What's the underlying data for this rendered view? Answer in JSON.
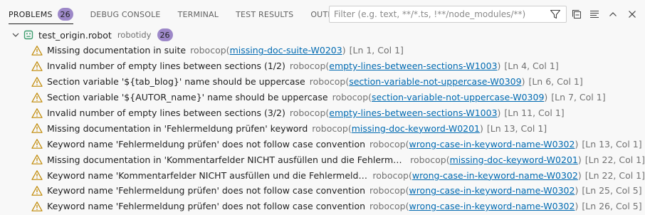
{
  "tabs": [
    {
      "label": "PROBLEMS",
      "badge": "26"
    },
    {
      "label": "DEBUG CONSOLE"
    },
    {
      "label": "TERMINAL"
    },
    {
      "label": "TEST RESULTS"
    },
    {
      "label": "OUTPUT"
    }
  ],
  "filter": {
    "placeholder": "Filter (e.g. text, **/*.ts, !**/node_modules/**)"
  },
  "file": {
    "name": "test_origin.robot",
    "dir": "robotidy",
    "count": "26"
  },
  "problems": [
    {
      "message": "Missing documentation in suite",
      "source": "robocop",
      "code": "missing-doc-suite-W0203",
      "location": "[Ln 1, Col 1]"
    },
    {
      "message": "Invalid number of empty lines between sections (1/2)",
      "source": "robocop",
      "code": "empty-lines-between-sections-W1003",
      "location": "[Ln 4, Col 1]"
    },
    {
      "message": "Section variable '${tab_blog}' name should be uppercase",
      "source": "robocop",
      "code": "section-variable-not-uppercase-W0309",
      "location": "[Ln 6, Col 1]"
    },
    {
      "message": "Section variable '${AUTOR_name}' name should be uppercase",
      "source": "robocop",
      "code": "section-variable-not-uppercase-W0309",
      "location": "[Ln 7, Col 1]"
    },
    {
      "message": "Invalid number of empty lines between sections (3/2)",
      "source": "robocop",
      "code": "empty-lines-between-sections-W1003",
      "location": "[Ln 11, Col 1]"
    },
    {
      "message": "Missing documentation in 'Fehlermeldung prüfen' keyword",
      "source": "robocop",
      "code": "missing-doc-keyword-W0201",
      "location": "[Ln 13, Col 1]"
    },
    {
      "message": "Keyword name 'Fehlermeldung prüfen' does not follow case convention",
      "source": "robocop",
      "code": "wrong-case-in-keyword-name-W0302",
      "location": "[Ln 13, Col 1]"
    },
    {
      "message": "Missing documentation in 'Kommentarfelder NICHT ausfüllen und die Fehlermeldung üb...",
      "source": "robocop",
      "code": "missing-doc-keyword-W0201",
      "location": "[Ln 22, Col 1]"
    },
    {
      "message": "Keyword name 'Kommentarfelder NICHT ausfüllen und die Fehlermeldung über...",
      "source": "robocop",
      "code": "wrong-case-in-keyword-name-W0302",
      "location": "[Ln 22, Col 1]"
    },
    {
      "message": "Keyword name 'Fehlermeldung prüfen' does not follow case convention",
      "source": "robocop",
      "code": "wrong-case-in-keyword-name-W0302",
      "location": "[Ln 25, Col 5]"
    },
    {
      "message": "Keyword name 'Fehlermeldung prüfen' does not follow case convention",
      "source": "robocop",
      "code": "wrong-case-in-keyword-name-W0302",
      "location": "[Ln 26, Col 5]"
    }
  ],
  "icons": {
    "warning": "warning-icon",
    "filter": "filter-icon",
    "collapse_all": "collapse-all-icon",
    "view_as_list": "view-as-list-icon",
    "maximize": "chevron-up-icon",
    "close": "close-icon",
    "file": "robot-file-icon"
  },
  "colors": {
    "badge": "#9d88c8",
    "warning": "#bf8803",
    "link": "#006ab1",
    "file_icon": "#3b9c6d"
  }
}
